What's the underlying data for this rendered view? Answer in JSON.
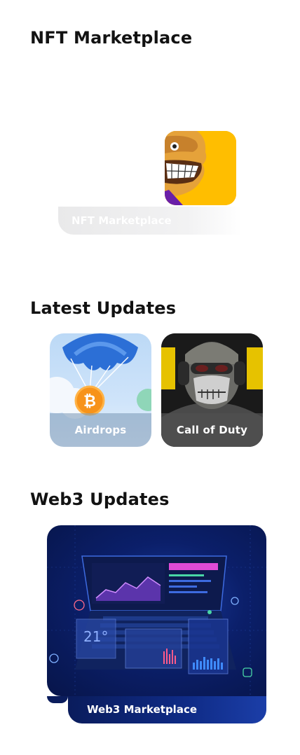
{
  "sections": {
    "nft": {
      "title": "NFT Marketplace",
      "card_label": "NFT Marketplace"
    },
    "latest": {
      "title": "Latest Updates",
      "tiles": [
        {
          "label": "Airdrops"
        },
        {
          "label": "Call of Duty"
        }
      ]
    },
    "web3": {
      "title": "Web3 Updates",
      "card_label": "Web3 Marketplace",
      "temperature": "21°"
    }
  },
  "colors": {
    "nft_thumb": "#ffbe00",
    "web3_bg": "#0b1f6a",
    "bitcoin": "#f7931a"
  }
}
